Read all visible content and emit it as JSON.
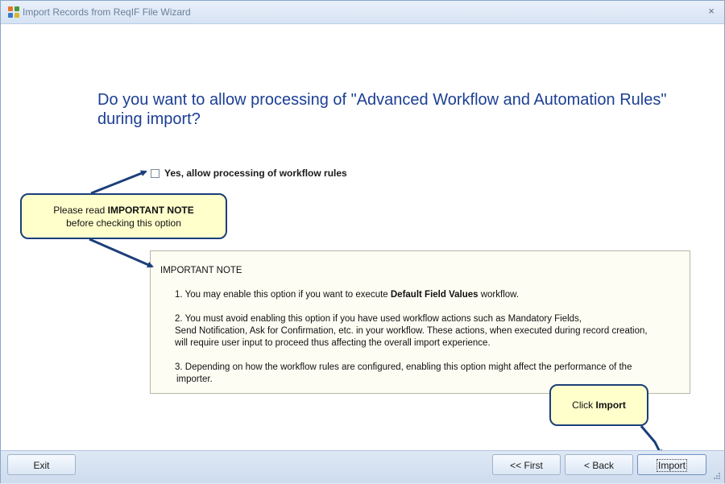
{
  "window": {
    "title": "Import Records from ReqIF File Wizard",
    "close_glyph": "×",
    "icon": "app-recycle-icon"
  },
  "main": {
    "question": "Do you want to allow processing of \"Advanced Workflow and Automation Rules\" during import?",
    "checkbox": {
      "label": "Yes, allow processing of workflow rules",
      "checked": false
    }
  },
  "callouts": {
    "read_note": {
      "prefix": "Please read ",
      "bold": "IMPORTANT NOTE",
      "line2": "before checking this option"
    },
    "click_import": {
      "prefix": "Click ",
      "bold": "Import"
    }
  },
  "note": {
    "title": "IMPORTANT NOTE",
    "item1": {
      "prefix": "1. You may enable this option if you want to execute ",
      "bold": "Default Field Values",
      "suffix": " workflow."
    },
    "item2": {
      "line1": "2. You must avoid enabling this option if you have used workflow actions such as Mandatory Fields,",
      "line2": "Send Notification, Ask for Confirmation, etc. in your workflow. These actions, when executed during record creation,",
      "line3": "will require user input to proceed thus affecting the overall import experience."
    },
    "item3": {
      "line1": "3. Depending on how the workflow rules are configured, enabling this option might affect the performance of the",
      "line2": "importer."
    }
  },
  "footer": {
    "exit_label": "Exit",
    "first_label": "<< First",
    "back_label": "< Back",
    "import_label": "Import"
  },
  "colors": {
    "question_text": "#1c3f94",
    "callout_bg": "#ffffcc",
    "callout_border": "#1b3f7a",
    "arrow": "#1b3f7a"
  }
}
